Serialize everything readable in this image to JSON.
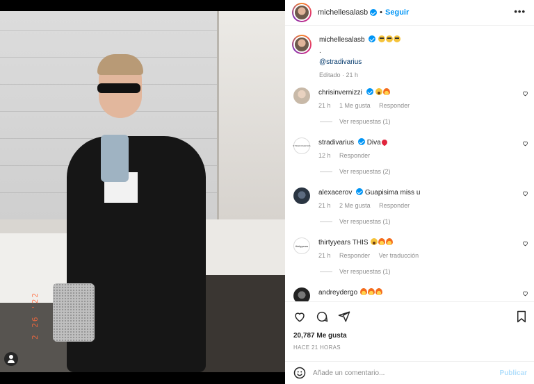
{
  "post": {
    "username": "michellesalasb",
    "follow_separator": "•",
    "follow_label": "Seguir",
    "more_label": "•••",
    "photo_datestamp": "2 26 '22"
  },
  "caption": {
    "username": "michellesalasb",
    "line2": ".",
    "mention": "@stradivarius",
    "meta": "Editado · 21 h"
  },
  "comments": [
    {
      "user": "chrisinvernizzi",
      "verified": true,
      "text": "",
      "emojis": [
        "scream",
        "fire"
      ],
      "time": "21 h",
      "likes": "1 Me gusta",
      "reply": "Responder",
      "extra": "",
      "replies": "Ver respuestas (1)"
    },
    {
      "user": "stradivarius",
      "verified": true,
      "text": "Diva",
      "emojis": [
        "heart"
      ],
      "time": "12 h",
      "likes": "",
      "reply": "Responder",
      "extra": "",
      "replies": "Ver respuestas (2)",
      "avatar_text": "STRADIVARIUS"
    },
    {
      "user": "alexacerov",
      "verified": true,
      "text": "Guapisima miss u",
      "emojis": [],
      "time": "21 h",
      "likes": "2 Me gusta",
      "reply": "Responder",
      "extra": "",
      "replies": "Ver respuestas (1)"
    },
    {
      "user": "thirtyyears",
      "verified": false,
      "text": "THIS",
      "emojis": [
        "scream",
        "fire",
        "fire"
      ],
      "time": "21 h",
      "likes": "",
      "reply": "Responder",
      "extra": "Ver traducción",
      "replies": "Ver respuestas (1)",
      "avatar_text": "thirtyyears"
    },
    {
      "user": "andreydergo",
      "verified": false,
      "text": "",
      "emojis": [
        "fire",
        "fire",
        "fire"
      ],
      "time": "",
      "likes": "",
      "reply": "",
      "extra": "",
      "replies": ""
    }
  ],
  "footer": {
    "likes": "20,787 Me gusta",
    "when": "HACE 21 HORAS",
    "comment_placeholder": "Añade un comentario...",
    "publish_label": "Publicar"
  },
  "colors": {
    "accent": "#0095f6",
    "text": "#262626",
    "muted": "#8e8e8e",
    "link": "#00376b"
  }
}
